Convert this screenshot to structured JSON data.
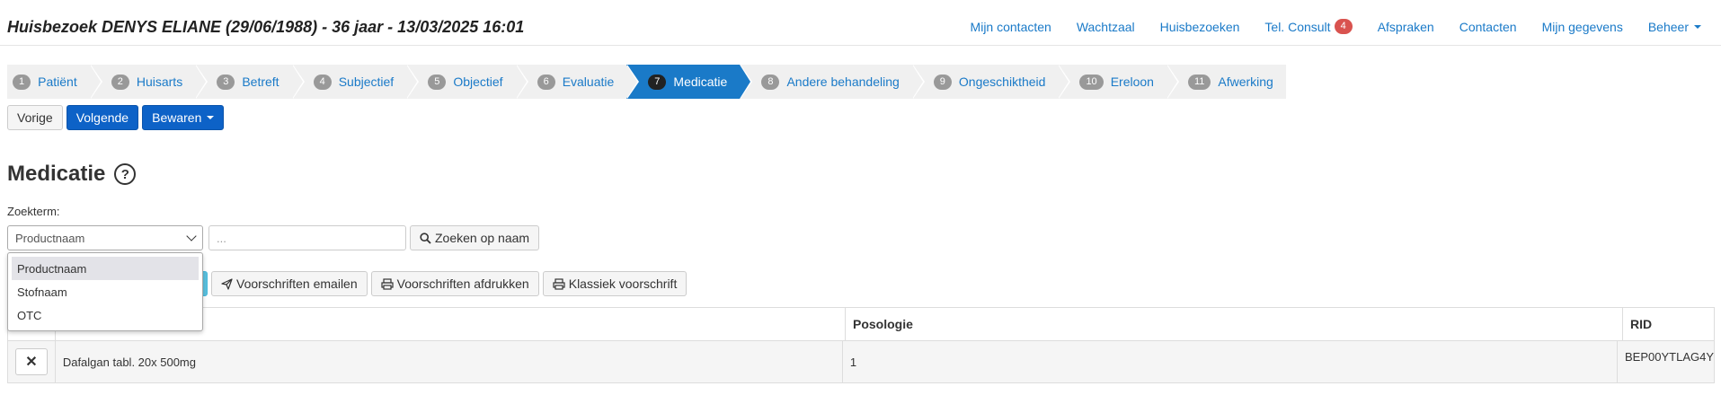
{
  "header": {
    "title": "Huisbezoek DENYS ELIANE (29/06/1988) - 36 jaar - 13/03/2025 16:01",
    "nav": [
      {
        "label": "Mijn contacten"
      },
      {
        "label": "Wachtzaal"
      },
      {
        "label": "Huisbezoeken"
      },
      {
        "label": "Tel. Consult",
        "badge": "4"
      },
      {
        "label": "Afspraken"
      },
      {
        "label": "Contacten"
      },
      {
        "label": "Mijn gegevens"
      },
      {
        "label": "Beheer"
      }
    ]
  },
  "wizard": {
    "steps": [
      {
        "num": "1",
        "label": "Patiënt"
      },
      {
        "num": "2",
        "label": "Huisarts"
      },
      {
        "num": "3",
        "label": "Betreft"
      },
      {
        "num": "4",
        "label": "Subjectief"
      },
      {
        "num": "5",
        "label": "Objectief"
      },
      {
        "num": "6",
        "label": "Evaluatie"
      },
      {
        "num": "7",
        "label": "Medicatie",
        "active": true
      },
      {
        "num": "8",
        "label": "Andere behandeling"
      },
      {
        "num": "9",
        "label": "Ongeschiktheid"
      },
      {
        "num": "10",
        "label": "Ereloon"
      },
      {
        "num": "11",
        "label": "Afwerking"
      }
    ]
  },
  "buttons": {
    "prev": "Vorige",
    "next": "Volgende",
    "save": "Bewaren"
  },
  "section": {
    "title": "Medicatie",
    "search_label": "Zoekterm:",
    "select_value": "Productnaam",
    "input_placeholder": "...",
    "search_button": "Zoeken op naam",
    "select_options": [
      "Productnaam",
      "Stofnaam",
      "OTC"
    ]
  },
  "actions": {
    "email": "Voorschriften emailen",
    "print": "Voorschriften afdrukken",
    "classic": "Klassiek voorschrift"
  },
  "table": {
    "headers": [
      "",
      "",
      "Posologie",
      "RID"
    ],
    "rows": [
      {
        "product": "Dafalgan tabl. 20x 500mg",
        "posologie": "1",
        "rid": "BEP00YTLAG4Y"
      }
    ]
  }
}
